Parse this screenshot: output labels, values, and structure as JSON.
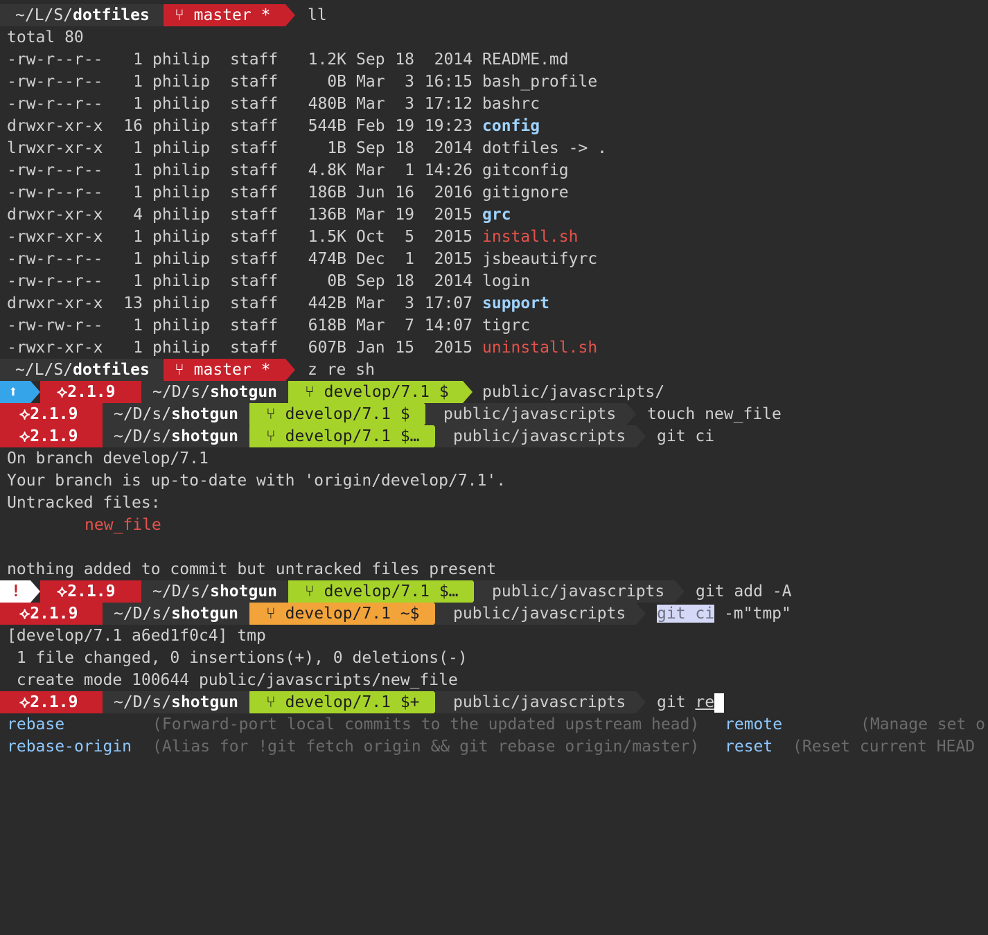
{
  "prompt1": {
    "dir_prefix": "~/L/S/",
    "dir_name": "dotfiles",
    "branch": "master",
    "flag": "*",
    "command": "ll"
  },
  "ls": {
    "total": "total 80",
    "rows": [
      {
        "perm": "-rw-r--r--",
        "links": "1",
        "user": "philip",
        "group": "staff",
        "size": "1.2K",
        "month": "Sep",
        "day": "18",
        "time": "2014",
        "name": "README.md",
        "kind": "file"
      },
      {
        "perm": "-rw-r--r--",
        "links": "1",
        "user": "philip",
        "group": "staff",
        "size": "0B",
        "month": "Mar",
        "day": "3",
        "time": "16:15",
        "name": "bash_profile",
        "kind": "file"
      },
      {
        "perm": "-rw-r--r--",
        "links": "1",
        "user": "philip",
        "group": "staff",
        "size": "480B",
        "month": "Mar",
        "day": "3",
        "time": "17:12",
        "name": "bashrc",
        "kind": "file"
      },
      {
        "perm": "drwxr-xr-x",
        "links": "16",
        "user": "philip",
        "group": "staff",
        "size": "544B",
        "month": "Feb",
        "day": "19",
        "time": "19:23",
        "name": "config",
        "kind": "dir"
      },
      {
        "perm": "lrwxr-xr-x",
        "links": "1",
        "user": "philip",
        "group": "staff",
        "size": "1B",
        "month": "Sep",
        "day": "18",
        "time": "2014",
        "name": "dotfiles",
        "link_target": "-> .",
        "kind": "link"
      },
      {
        "perm": "-rw-r--r--",
        "links": "1",
        "user": "philip",
        "group": "staff",
        "size": "4.8K",
        "month": "Mar",
        "day": "1",
        "time": "14:26",
        "name": "gitconfig",
        "kind": "file"
      },
      {
        "perm": "-rw-r--r--",
        "links": "1",
        "user": "philip",
        "group": "staff",
        "size": "186B",
        "month": "Jun",
        "day": "16",
        "time": "2016",
        "name": "gitignore",
        "kind": "file"
      },
      {
        "perm": "drwxr-xr-x",
        "links": "4",
        "user": "philip",
        "group": "staff",
        "size": "136B",
        "month": "Mar",
        "day": "19",
        "time": "2015",
        "name": "grc",
        "kind": "dir"
      },
      {
        "perm": "-rwxr-xr-x",
        "links": "1",
        "user": "philip",
        "group": "staff",
        "size": "1.5K",
        "month": "Oct",
        "day": "5",
        "time": "2015",
        "name": "install.sh",
        "kind": "exec"
      },
      {
        "perm": "-rw-r--r--",
        "links": "1",
        "user": "philip",
        "group": "staff",
        "size": "474B",
        "month": "Dec",
        "day": "1",
        "time": "2015",
        "name": "jsbeautifyrc",
        "kind": "file"
      },
      {
        "perm": "-rw-r--r--",
        "links": "1",
        "user": "philip",
        "group": "staff",
        "size": "0B",
        "month": "Sep",
        "day": "18",
        "time": "2014",
        "name": "login",
        "kind": "file"
      },
      {
        "perm": "drwxr-xr-x",
        "links": "13",
        "user": "philip",
        "group": "staff",
        "size": "442B",
        "month": "Mar",
        "day": "3",
        "time": "17:07",
        "name": "support",
        "kind": "dir"
      },
      {
        "perm": "-rw-rw-r--",
        "links": "1",
        "user": "philip",
        "group": "staff",
        "size": "618B",
        "month": "Mar",
        "day": "7",
        "time": "14:07",
        "name": "tigrc",
        "kind": "file"
      },
      {
        "perm": "-rwxr-xr-x",
        "links": "1",
        "user": "philip",
        "group": "staff",
        "size": "607B",
        "month": "Jan",
        "day": "15",
        "time": "2015",
        "name": "uninstall.sh",
        "kind": "exec"
      }
    ]
  },
  "prompt2": {
    "dir_prefix": "~/L/S/",
    "dir_name": "dotfiles",
    "branch": "master",
    "flag": "*",
    "command": "z re sh"
  },
  "ruby_version": "2.1.9",
  "shotgun_prefix": "~/D/s/",
  "shotgun_name": "shotgun",
  "prompt3": {
    "status_icon": "up-arrow-icon",
    "branch": "develop/7.1 $",
    "command": "public/javascripts/"
  },
  "prompt4": {
    "branch": "develop/7.1 $",
    "path": "public/javascripts",
    "command": "touch new_file"
  },
  "prompt5": {
    "branch": "develop/7.1 $…",
    "path": "public/javascripts",
    "command": "git ci"
  },
  "git_status": {
    "line1": "On branch develop/7.1",
    "line2": "Your branch is up-to-date with 'origin/develop/7.1'.",
    "line3": "Untracked files:",
    "untracked": "new_file",
    "line4": "nothing added to commit but untracked files present"
  },
  "prompt6": {
    "status_text": "!",
    "branch": "develop/7.1 $…",
    "path": "public/javascripts",
    "command": "git add -A"
  },
  "prompt7": {
    "branch": "develop/7.1 ~$",
    "path": "public/javascripts",
    "command_sel": "git ci",
    "command_rest": " -m\"tmp\""
  },
  "commit_out": {
    "line1": "[develop/7.1 a6ed1f0c4] tmp",
    "line2": " 1 file changed, 0 insertions(+), 0 deletions(-)",
    "line3": " create mode 100644 public/javascripts/new_file"
  },
  "prompt8": {
    "branch": "develop/7.1 $+",
    "path": "public/javascripts",
    "cmd_prefix": "git ",
    "cmd_typed": "re"
  },
  "completions": [
    {
      "hl": "re",
      "rest": "base",
      "desc": "(Forward-port local commits to the updated upstream head)"
    },
    {
      "hl": "re",
      "rest": "base-origin",
      "desc": "(Alias for !git fetch origin && git rebase origin/master)"
    },
    {
      "hl": "re",
      "rest": "mote",
      "desc": "(Manage set o"
    },
    {
      "hl": "re",
      "rest": "set",
      "desc": "(Reset current HEAD"
    }
  ],
  "colors": {
    "red": "#c8212b",
    "green": "#a6d32a",
    "orange": "#f2a33a",
    "blue": "#36a4e8",
    "bg": "#2b2b2b"
  }
}
